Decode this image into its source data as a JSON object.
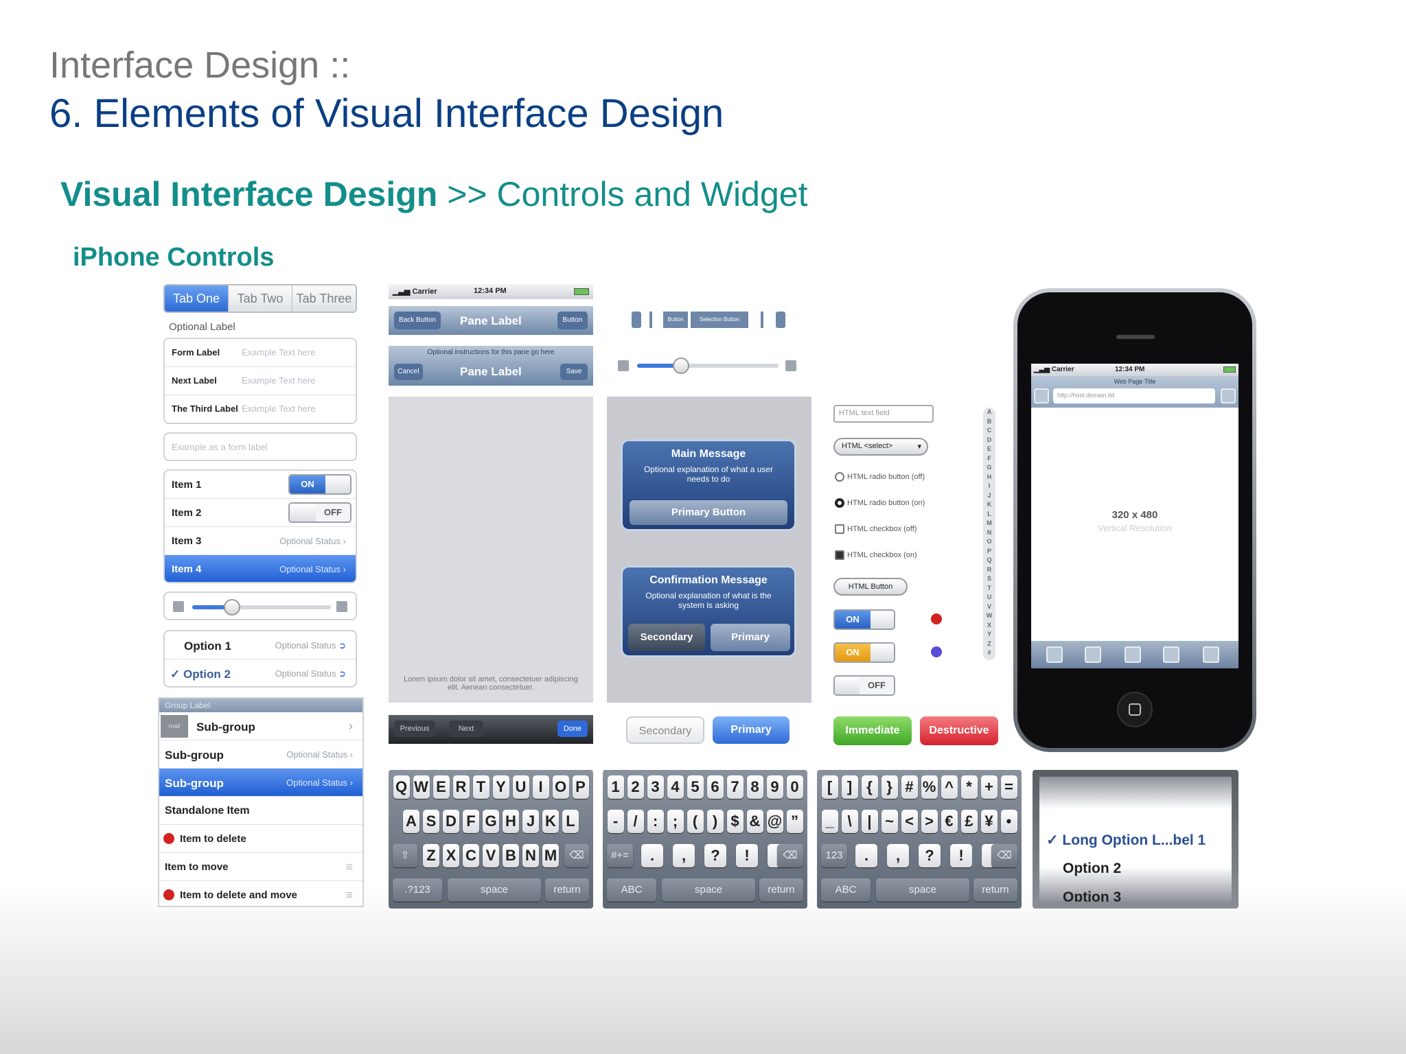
{
  "header": {
    "line1": "Interface Design ::",
    "line2": "6. Elements of Visual Interface Design",
    "section_bold": "Visual Interface Design",
    "section_rest": " >> Controls and Widget",
    "subheading": "iPhone Controls"
  },
  "col1": {
    "tabs": [
      "Tab One",
      "Tab Two",
      "Tab Three"
    ],
    "optional_label": "Optional Label",
    "form": [
      {
        "label": "Form Label",
        "ph": "Example Text here"
      },
      {
        "label": "Next Label",
        "ph": "Example Text here"
      },
      {
        "label": "The Third Label",
        "ph": "Example Text here"
      }
    ],
    "form_single_ph": "Example as a form label",
    "items": [
      {
        "label": "Item 1",
        "on": "ON"
      },
      {
        "label": "Item 2",
        "off": "OFF"
      },
      {
        "label": "Item 3",
        "status": "Optional Status"
      },
      {
        "label": "Item 4",
        "status": "Optional Status"
      }
    ],
    "options": [
      {
        "label": "Option 1",
        "status": "Optional Status"
      },
      {
        "label": "✓ Option 2",
        "status": "Optional Status"
      }
    ],
    "group_label": "Group Label",
    "groups": [
      {
        "label": "Sub-group",
        "status": ""
      },
      {
        "label": "Sub-group",
        "status": "Optional Status"
      },
      {
        "label": "Sub-group",
        "status": "Optional Status"
      },
      {
        "label": "Standalone Item"
      },
      {
        "label": "Item to delete"
      },
      {
        "label": "Item to move"
      },
      {
        "label": "Item to delete and move"
      }
    ],
    "thumb_text": "mail"
  },
  "col2": {
    "status": {
      "carrier": "Carrier",
      "time": "12:34 PM"
    },
    "nav1": {
      "back": "Back Button",
      "title": "Pane Label",
      "button": "Button"
    },
    "nav2": {
      "prompt": "Optional instructions for this pane go here",
      "cancel": "Cancel",
      "title": "Pane Label",
      "save": "Save"
    },
    "lorem": "Lorem ipsum dolor sit amet, consectetuer adipiscing elit. Aenean consectetuer.",
    "toolbar": {
      "previous": "Previous",
      "next": "Next",
      "done": "Done"
    },
    "kb_rows": [
      [
        "Q",
        "W",
        "E",
        "R",
        "T",
        "Y",
        "U",
        "I",
        "O",
        "P"
      ],
      [
        "A",
        "S",
        "D",
        "F",
        "G",
        "H",
        "J",
        "K",
        "L"
      ],
      [
        "Z",
        "X",
        "C",
        "V",
        "B",
        "N",
        "M"
      ]
    ],
    "kb_bottom": {
      "left": ".?123",
      "space": "space",
      "ret": "return"
    }
  },
  "col3": {
    "seg": {
      "button": "Button",
      "selection": "Selection Button"
    },
    "alert1": {
      "title": "Main Message",
      "body": "Optional explanation of what a user needs to do",
      "button": "Primary Button"
    },
    "alert2": {
      "title": "Confirmation Message",
      "body": "Optional explanation of what is the system is asking",
      "secondary": "Secondary",
      "primary": "Primary"
    },
    "btns": {
      "secondary": "Secondary",
      "primary": "Primary"
    },
    "kb_rows": [
      [
        "1",
        "2",
        "3",
        "4",
        "5",
        "6",
        "7",
        "8",
        "9",
        "0"
      ],
      [
        "-",
        "/",
        ":",
        ";",
        "(",
        ")",
        "$",
        "&",
        "@",
        "”"
      ]
    ],
    "kb_row3": [
      ".",
      ",",
      "?",
      "!",
      "’"
    ],
    "kb_bottom": {
      "left": "ABC",
      "space": "space",
      "ret": "return",
      "sym": "#+="
    }
  },
  "col4": {
    "textfield": "HTML text field",
    "select": "HTML <select>",
    "radio_off": "HTML radio button (off)",
    "radio_on": "HTML radio button (on)",
    "check_off": "HTML checkbox (off)",
    "check_on": "HTML checkbox (on)",
    "button": "HTML Button",
    "on": "ON",
    "off": "OFF",
    "immediate": "Immediate",
    "destructive": "Destructive",
    "index": [
      "A",
      "B",
      "C",
      "D",
      "E",
      "F",
      "G",
      "H",
      "I",
      "J",
      "K",
      "L",
      "M",
      "N",
      "O",
      "P",
      "Q",
      "R",
      "S",
      "T",
      "U",
      "V",
      "W",
      "X",
      "Y",
      "Z",
      "#"
    ],
    "kb_rows": [
      [
        "[",
        "]",
        "{",
        "}",
        "#",
        "%",
        "^",
        "*",
        "+",
        "="
      ],
      [
        "_",
        "\\",
        "|",
        "~",
        "<",
        ">",
        "€",
        "£",
        "¥",
        "•"
      ]
    ],
    "kb_row3": [
      ".",
      ",",
      "?",
      "!",
      "’"
    ],
    "kb_bottom": {
      "left": "ABC",
      "space": "space",
      "ret": "return",
      "sym": "123"
    }
  },
  "phone": {
    "carrier": "Carrier",
    "time": "12:34 PM",
    "page_title": "Web Page Title",
    "url": "http://host.domain.tld",
    "res": "320 x 480",
    "res_sub": "Vertical Resolution"
  },
  "picker": [
    "✓ Long Option L...bel 1",
    "Option 2",
    "Option 3"
  ]
}
